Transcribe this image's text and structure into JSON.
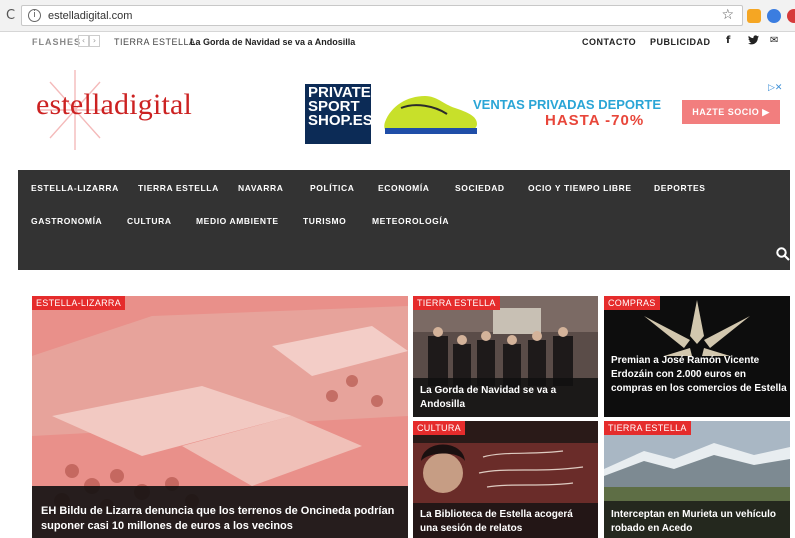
{
  "browser": {
    "url": "estelladigital.com"
  },
  "topbar": {
    "flashes_label": "FLASHES",
    "prev": "‹",
    "next": "›",
    "flash_category": "TIERRA ESTELLA",
    "flash_title": "La Gorda de Navidad se va a Andosilla",
    "contacto": "CONTACTO",
    "publicidad": "PUBLICIDAD",
    "social": [
      "f",
      "🐦",
      "✉"
    ]
  },
  "header": {
    "logo_text": "estelladigital"
  },
  "ad": {
    "brand": "PRIVATE SPORT SHOP.ES",
    "title": "VENTAS PRIVADAS DEPORTE",
    "price": "HASTA -70%",
    "cta": "HAZTE SOCIO ▶"
  },
  "nav": {
    "row1": [
      "ESTELLA-LIZARRA",
      "TIERRA ESTELLA",
      "NAVARRA",
      "POLÍTICA",
      "ECONOMÍA",
      "SOCIEDAD",
      "OCIO Y TIEMPO LIBRE",
      "DEPORTES"
    ],
    "row2": [
      "GASTRONOMÍA",
      "CULTURA",
      "MEDIO AMBIENTE",
      "TURISMO",
      "METEOROLOGÍA"
    ]
  },
  "articles": [
    {
      "category": "ESTELLA-LIZARRA",
      "title": "EH Bildu de Lizarra denuncia que los terrenos de Oncineda podrían suponer casi 10 millones de euros a los vecinos"
    },
    {
      "category": "TIERRA ESTELLA",
      "title": "La Gorda de Navidad se va a Andosilla"
    },
    {
      "category": "COMPRAS",
      "title": "Premian a José Ramón Vicente Erdozáin con 2.000 euros en compras en los comercios de Estella"
    },
    {
      "category": "CULTURA",
      "title": "La Biblioteca de Estella acogerá una sesión de relatos"
    },
    {
      "category": "TIERRA ESTELLA",
      "title": "Interceptan en Murieta un vehículo robado en Acedo"
    }
  ],
  "colors": {
    "accent": "#e52c2c",
    "nav_bg": "#333333"
  }
}
